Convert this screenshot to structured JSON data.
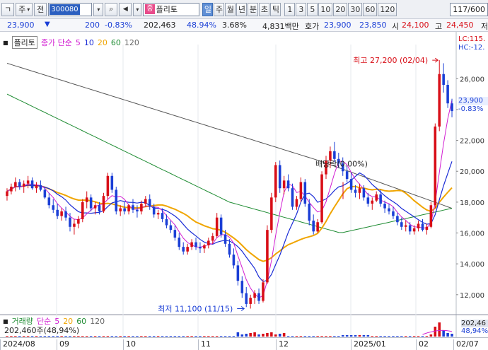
{
  "toolbar": {
    "menu_icon_label": "ㄱ",
    "market_label": "주",
    "market_arrow": "▾",
    "info_label": "전",
    "stock_code": "300080",
    "code_arrow": "▾",
    "search_icon": "⌕",
    "sound_icon": "◀",
    "nav_label": "▾",
    "name_badge": "중",
    "stock_name": "플리토",
    "periods": [
      "일",
      "주",
      "월",
      "년",
      "분",
      "초",
      "틱"
    ],
    "intervals": [
      "1",
      "3",
      "5",
      "10",
      "20",
      "30",
      "60",
      "120"
    ],
    "active_period": "일",
    "count_display": "117/600"
  },
  "quote": {
    "price": "23,900",
    "arrow": "▼",
    "change": "200",
    "change_pct": "-0.83%",
    "volume": "202,463",
    "vol_ratio": "48.94%",
    "turnover_ratio": "3.68%",
    "trade_value": "4,831백만",
    "ask_label": "호가",
    "ask_price": "23,900",
    "bid_price": "23,850",
    "open_label": "시",
    "open_price": "24,100",
    "high_label": "고",
    "high_price": "24,450",
    "low_label": "저"
  },
  "chart": {
    "name_tag": "플리토",
    "legend_title": "종가 단순",
    "ma_periods": [
      "5",
      "10",
      "20",
      "60",
      "120"
    ],
    "ma_colors": [
      "#d21ed2",
      "#1a2cd6",
      "#f0a500",
      "#1f8c33",
      "#555555"
    ],
    "lc_label": "LC:115.",
    "hc_label": "HC:-12.",
    "price_current": "23,900",
    "price_change": "-0.83%",
    "high_annotation": "최고 27,200 (02/04)",
    "low_annotation": "최저 11,100 (11/15)",
    "dividend_annotation": "배당락(0.00%)",
    "y_ticks": [
      "26,000",
      "24,000",
      "22,000",
      "20,000",
      "18,000",
      "16,000",
      "14,000",
      "12,000"
    ]
  },
  "volume_panel": {
    "title": "거래량",
    "legend_title": "단순",
    "ma_periods": [
      "5",
      "20",
      "60",
      "120"
    ],
    "volume_text": "202,460주(48,94%)",
    "volume_right": "202,46",
    "pct_right": "48,94%"
  },
  "x_axis": [
    "2024/08",
    "09",
    "10",
    "11",
    "12",
    "2025/01",
    "02",
    "02/07"
  ],
  "chart_data": {
    "type": "candlestick",
    "title": "플리토",
    "y_range": [
      10800,
      27800
    ],
    "up_color": "#d80e17",
    "down_color": "#1b3fd6",
    "candles": [
      [
        18400,
        18900,
        18100,
        18700
      ],
      [
        18700,
        19200,
        18500,
        19000
      ],
      [
        19000,
        19600,
        18700,
        19300
      ],
      [
        19300,
        19500,
        18800,
        19000
      ],
      [
        19000,
        19400,
        18600,
        19200
      ],
      [
        19200,
        19700,
        18900,
        19400
      ],
      [
        19400,
        19600,
        18800,
        18900
      ],
      [
        18900,
        19300,
        18600,
        19100
      ],
      [
        19100,
        19400,
        18700,
        18800
      ],
      [
        18800,
        19000,
        18200,
        18300
      ],
      [
        18300,
        18600,
        17600,
        17800
      ],
      [
        17800,
        18200,
        17300,
        17500
      ],
      [
        17500,
        17900,
        16900,
        17100
      ],
      [
        17100,
        17600,
        16800,
        17400
      ],
      [
        17400,
        17700,
        16800,
        17000
      ],
      [
        17000,
        17300,
        16100,
        16400
      ],
      [
        16400,
        16900,
        15900,
        16600
      ],
      [
        16600,
        17100,
        16300,
        16900
      ],
      [
        16900,
        18200,
        16700,
        18000
      ],
      [
        18000,
        18700,
        17600,
        18300
      ],
      [
        18300,
        18500,
        17400,
        17600
      ],
      [
        17600,
        18000,
        17200,
        17800
      ],
      [
        17800,
        18000,
        17200,
        17400
      ],
      [
        17400,
        18600,
        17300,
        18400
      ],
      [
        18400,
        19900,
        18200,
        19700
      ],
      [
        19700,
        19900,
        18600,
        18800
      ],
      [
        18800,
        19000,
        17200,
        17400
      ],
      [
        17400,
        17800,
        17100,
        17600
      ],
      [
        17600,
        18000,
        17200,
        17400
      ],
      [
        17400,
        17900,
        17200,
        17800
      ],
      [
        17800,
        18200,
        17300,
        17500
      ],
      [
        17500,
        17800,
        17000,
        17400
      ],
      [
        17400,
        18100,
        17200,
        17900
      ],
      [
        17900,
        18400,
        17700,
        18200
      ],
      [
        18200,
        18500,
        17500,
        17700
      ],
      [
        17700,
        17900,
        17000,
        17200
      ],
      [
        17200,
        17500,
        16900,
        17300
      ],
      [
        17300,
        17600,
        16700,
        16900
      ],
      [
        16900,
        17200,
        16300,
        16500
      ],
      [
        16500,
        16800,
        16000,
        16200
      ],
      [
        16200,
        16500,
        15500,
        15700
      ],
      [
        15700,
        16000,
        14900,
        15100
      ],
      [
        15100,
        15400,
        14600,
        14800
      ],
      [
        14800,
        15300,
        14600,
        15100
      ],
      [
        15100,
        15600,
        14900,
        15400
      ],
      [
        15400,
        15700,
        14900,
        15100
      ],
      [
        15100,
        15400,
        14700,
        15000
      ],
      [
        15000,
        15300,
        14700,
        15200
      ],
      [
        15200,
        15700,
        15000,
        15500
      ],
      [
        15500,
        16000,
        15300,
        15800
      ],
      [
        15800,
        17300,
        15700,
        17000
      ],
      [
        17000,
        17200,
        15700,
        15900
      ],
      [
        15900,
        16200,
        15100,
        15300
      ],
      [
        15300,
        15600,
        14400,
        14600
      ],
      [
        14600,
        15000,
        13700,
        13900
      ],
      [
        13900,
        14200,
        12600,
        12900
      ],
      [
        12900,
        13200,
        11800,
        12100
      ],
      [
        12100,
        12500,
        11200,
        11400
      ],
      [
        11400,
        12000,
        11100,
        11800
      ],
      [
        11800,
        12300,
        11400,
        12100
      ],
      [
        12100,
        12400,
        11400,
        11600
      ],
      [
        11600,
        13000,
        11500,
        12800
      ],
      [
        12800,
        16500,
        12700,
        16200
      ],
      [
        16200,
        18600,
        16000,
        18300
      ],
      [
        18300,
        20600,
        18000,
        20400
      ],
      [
        20400,
        20700,
        18600,
        18900
      ],
      [
        18900,
        19700,
        18500,
        19400
      ],
      [
        19400,
        19800,
        18700,
        18900
      ],
      [
        18900,
        19200,
        17500,
        17700
      ],
      [
        17700,
        18400,
        17500,
        18200
      ],
      [
        18200,
        19600,
        18000,
        19300
      ],
      [
        19300,
        19500,
        17700,
        17900
      ],
      [
        17900,
        18200,
        16500,
        16800
      ],
      [
        16800,
        17200,
        15900,
        16100
      ],
      [
        16100,
        16900,
        16000,
        16700
      ],
      [
        16700,
        20000,
        16600,
        19800
      ],
      [
        19800,
        21000,
        19500,
        20700
      ],
      [
        20700,
        21600,
        20200,
        21300
      ],
      [
        21300,
        21900,
        20600,
        20800
      ],
      [
        20800,
        21200,
        20200,
        20500
      ],
      [
        20500,
        20900,
        19700,
        20000
      ],
      [
        20000,
        20300,
        19300,
        19500
      ],
      [
        19500,
        19900,
        18600,
        18800
      ],
      [
        18800,
        19100,
        18300,
        18600
      ],
      [
        18600,
        19200,
        18200,
        18900
      ],
      [
        18900,
        19100,
        18100,
        18300
      ],
      [
        18300,
        18600,
        17700,
        17900
      ],
      [
        17900,
        18300,
        17500,
        18100
      ],
      [
        18100,
        18700,
        18000,
        18500
      ],
      [
        18500,
        18800,
        17700,
        17900
      ],
      [
        17900,
        18100,
        17300,
        17600
      ],
      [
        17600,
        17900,
        17200,
        17400
      ],
      [
        17400,
        17700,
        16900,
        17100
      ],
      [
        17100,
        17300,
        16500,
        16700
      ],
      [
        16700,
        17000,
        16200,
        16400
      ],
      [
        16400,
        16800,
        16100,
        16500
      ],
      [
        16500,
        16700,
        15900,
        16100
      ],
      [
        16100,
        16500,
        15900,
        16300
      ],
      [
        16300,
        16800,
        16100,
        16600
      ],
      [
        16600,
        16900,
        16100,
        16200
      ],
      [
        16200,
        16600,
        15900,
        16400
      ],
      [
        16400,
        18000,
        16300,
        17800
      ],
      [
        17800,
        23100,
        17600,
        22900
      ],
      [
        22900,
        27200,
        22600,
        26300
      ],
      [
        26300,
        27000,
        25100,
        25600
      ],
      [
        25600,
        25900,
        24100,
        24400
      ],
      [
        24400,
        24700,
        23500,
        23900
      ]
    ]
  }
}
